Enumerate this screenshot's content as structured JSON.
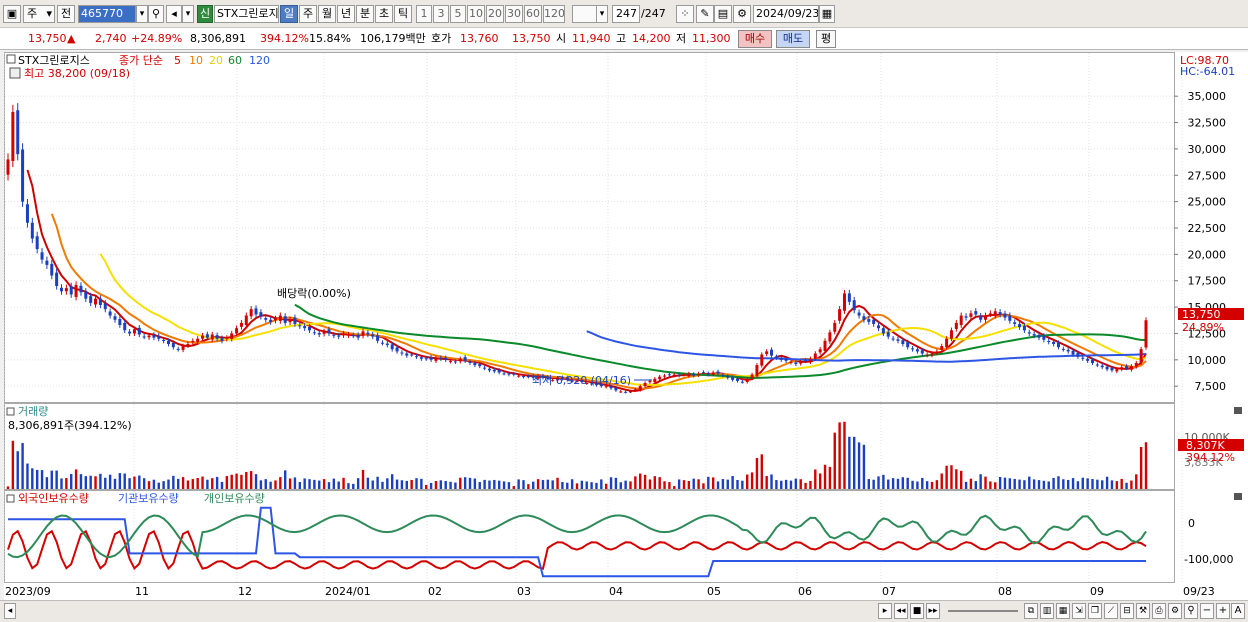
{
  "toolbar": {
    "market": "주",
    "prev": "전",
    "code": "465770",
    "shin": "신",
    "stock_name": "STX그린로지",
    "periods": [
      "일",
      "주",
      "월",
      "년",
      "분",
      "초",
      "틱"
    ],
    "intervals": [
      "1",
      "3",
      "5",
      "10",
      "20",
      "30",
      "60",
      "120"
    ],
    "count": "247",
    "total": "/247",
    "date": "2024/09/23"
  },
  "quote": {
    "price": "13,750",
    "change_arrow": "▲",
    "change": "2,740",
    "change_pct": "+24.89%",
    "volume": "8,306,891",
    "vol_ratio": "394.12%",
    "turnover": "15.84%",
    "amount": "106,179백만",
    "hoga_label": "호가",
    "ask": "13,760",
    "bid": "13,750",
    "open_label": "시",
    "open": "11,940",
    "high_label": "고",
    "high": "14,200",
    "low_label": "저",
    "low": "11,300",
    "buy_label": "매수",
    "sell_label": "매도",
    "eval_label": "평"
  },
  "price_panel": {
    "stock": "STX그린로지스",
    "ma_label": "종가 단순",
    "ma_periods": [
      "5",
      "10",
      "20",
      "60",
      "120"
    ],
    "ma_colors": [
      "#cc0000",
      "#f07a00",
      "#f5e000",
      "#0a8a2a",
      "#2e56e6"
    ],
    "high_note": "최고 38,200 (09/18)",
    "low_note": "최저 6,920 (04/16)",
    "dividend_note": "배당락(0.00%)",
    "lc": "LC:98.70",
    "hc": "HC:-64.01",
    "y_ticks": [
      "35,000",
      "32,500",
      "30,000",
      "27,500",
      "25,000",
      "22,500",
      "20,000",
      "17,500",
      "15,000",
      "12,500",
      "10,000",
      "7,500"
    ],
    "y_values": [
      35000,
      32500,
      30000,
      27500,
      25000,
      22500,
      20000,
      17500,
      15000,
      12500,
      10000,
      7500
    ],
    "price_tag": "13,750",
    "pct_tag": "24.89%"
  },
  "volume_panel": {
    "title": "거래량",
    "subtitle": "8,306,891주(394.12%)",
    "y_tick": "10,000K",
    "vol_tag": "8,307K",
    "pct_tag": "394.12%",
    "tag3": "3,833K"
  },
  "holding_panel": {
    "legend": [
      "외국인보유수량",
      "기관보유수량",
      "개인보유수량"
    ],
    "legend_colors": [
      "#d40000",
      "#2e56e6",
      "#2e8a58"
    ],
    "y_ticks": [
      "0",
      "-100,000"
    ]
  },
  "x_axis": [
    "2023/09",
    "11",
    "12",
    "2024/01",
    "02",
    "03",
    "04",
    "05",
    "06",
    "07",
    "08",
    "09",
    "09/23"
  ],
  "chart_data": {
    "type": "candlestick",
    "title": "STX그린로지스",
    "ylim": [
      6000,
      39000
    ],
    "close": [
      29000,
      33500,
      29500,
      25000,
      23000,
      21500,
      20500,
      19500,
      19000,
      18000,
      17000,
      16500,
      16800,
      16200,
      17100,
      16400,
      15800,
      15400,
      15800,
      15200,
      14800,
      14200,
      13800,
      13300,
      12800,
      12500,
      12900,
      12400,
      12200,
      12300,
      12100,
      12000,
      11800,
      11500,
      11200,
      11000,
      11300,
      11500,
      11800,
      12000,
      12300,
      12100,
      12400,
      12000,
      11800,
      12100,
      12500,
      13000,
      13500,
      14200,
      14800,
      14300,
      14100,
      13800,
      13600,
      13900,
      14200,
      13500,
      13800,
      13400,
      13200,
      13000,
      12800,
      12600,
      12400,
      12700,
      12500,
      12300,
      12200,
      12500,
      12400,
      12300,
      12100,
      12700,
      12400,
      12200,
      11800,
      11600,
      11400,
      11000,
      10800,
      10600,
      10400,
      10500,
      10300,
      10100,
      10100,
      10000,
      10200,
      10100,
      10000,
      9900,
      9800,
      10100,
      9900,
      9700,
      9500,
      9400,
      9200,
      9000,
      8900,
      8800,
      8700,
      8600,
      8600,
      8500,
      8400,
      8400,
      8300,
      8500,
      8300,
      8200,
      8100,
      8300,
      8200,
      8100,
      8000,
      8000,
      7900,
      7800,
      7700,
      7600,
      7500,
      7500,
      7300,
      7100,
      7000,
      6950,
      7000,
      7200,
      7500,
      7800,
      8000,
      8200,
      8400,
      8500,
      8600,
      8600,
      8500,
      8600,
      8700,
      8500,
      8700,
      8800,
      8600,
      8800,
      8700,
      8500,
      8300,
      8100,
      8000,
      7900,
      8200,
      8600,
      9500,
      10500,
      10800,
      10400,
      10200,
      10000,
      9900,
      9800,
      9600,
      9800,
      9900,
      10100,
      10600,
      11000,
      11800,
      12600,
      13500,
      14800,
      16300,
      15500,
      14700,
      14200,
      13800,
      13600,
      13400,
      13000,
      12500,
      12200,
      12000,
      11800,
      11500,
      11200,
      11000,
      10800,
      10600,
      10500,
      10600,
      10800,
      11300,
      12000,
      12800,
      13500,
      14200,
      14000,
      14400,
      14300,
      13800,
      14200,
      14400,
      14600,
      14300,
      14000,
      13700,
      13400,
      13100,
      12800,
      12500,
      12300,
      12100,
      11900,
      11700,
      11500,
      11200,
      11000,
      10800,
      10500,
      10300,
      10100,
      9900,
      9700,
      9500,
      9300,
      9100,
      9000,
      9100,
      9300,
      9200,
      9400,
      9700,
      11010,
      13750
    ]
  }
}
